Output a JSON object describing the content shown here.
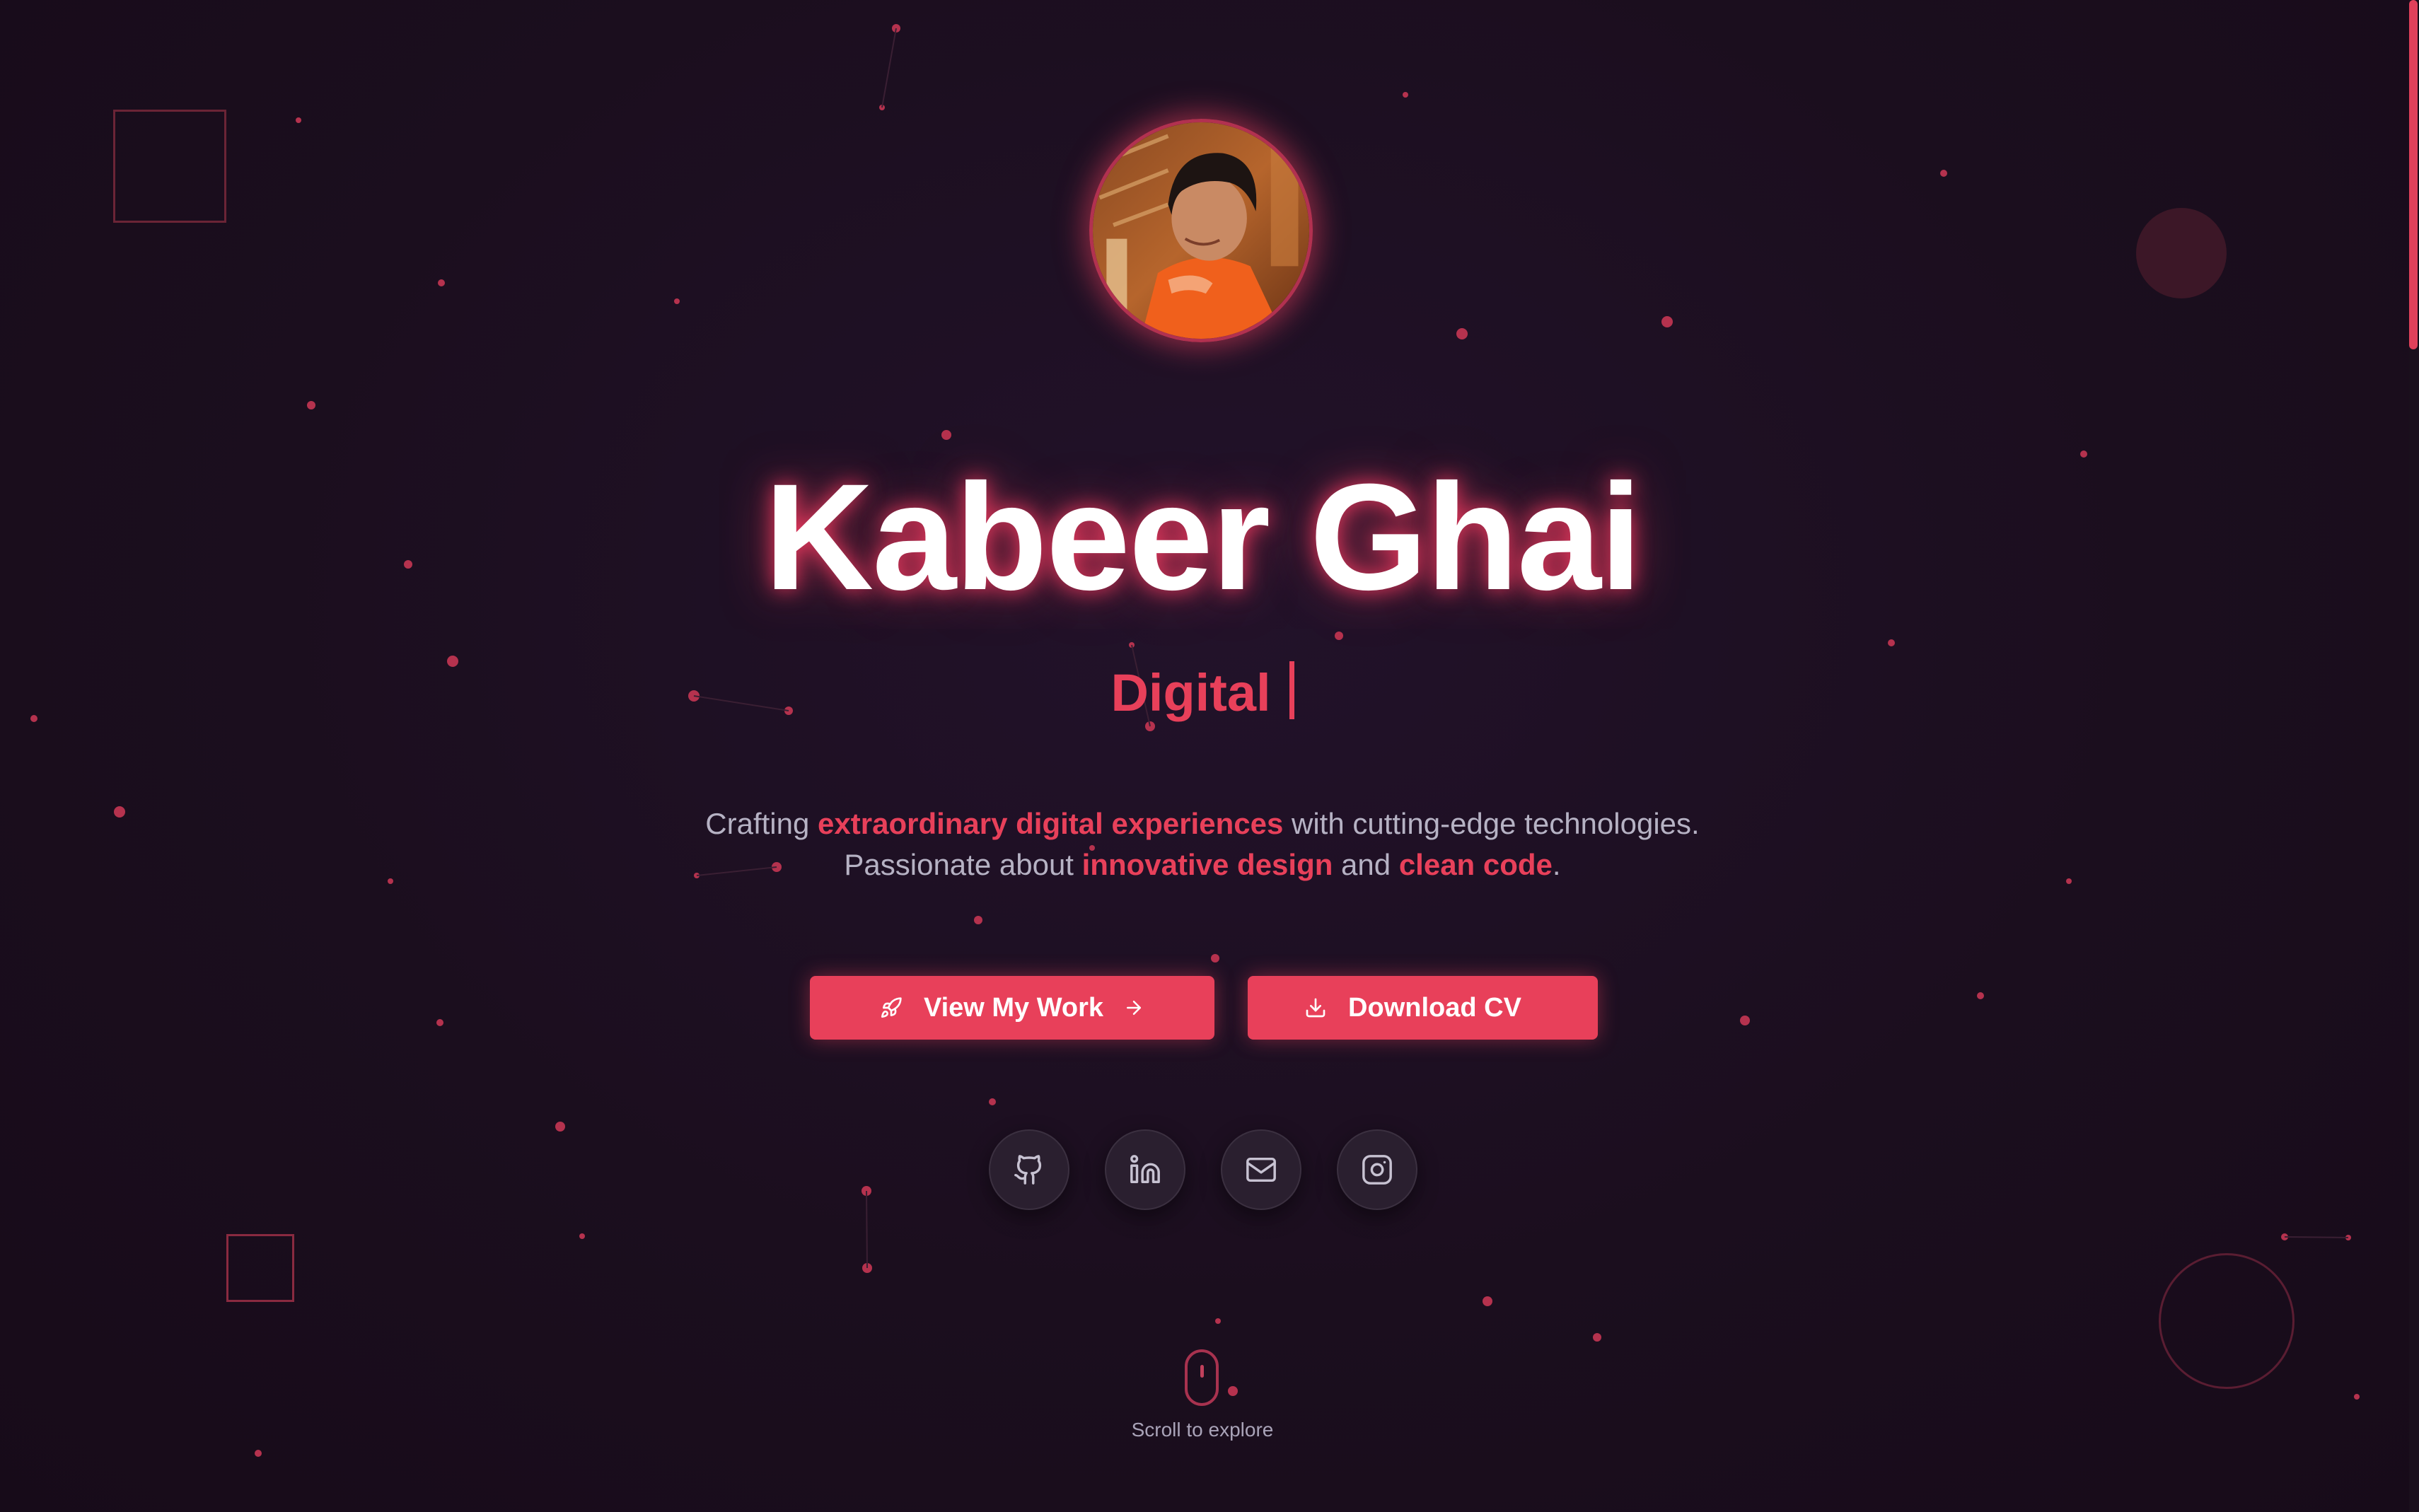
{
  "profile": {
    "name": "Kabeer Ghai",
    "role_typed": "Digital",
    "avatar_alt": "Profile photo"
  },
  "tagline": {
    "line1_a": "Crafting ",
    "line1_highlight": "extraordinary digital experiences",
    "line1_b": " with cutting-edge technologies.",
    "line2_a": "Passionate about ",
    "line2_highlight1": "innovative design",
    "line2_mid": " and ",
    "line2_highlight2": "clean code",
    "line2_end": "."
  },
  "actions": {
    "view_work_label": "View My Work",
    "download_cv_label": "Download CV"
  },
  "social": [
    {
      "icon": "github-icon"
    },
    {
      "icon": "linkedin-icon"
    },
    {
      "icon": "mail-icon"
    },
    {
      "icon": "instagram-icon"
    }
  ],
  "scroll_hint": "Scroll to explore",
  "colors": {
    "background": "#1b0e1e",
    "accent": "#e8405a",
    "text_muted": "#b6b2c4"
  }
}
